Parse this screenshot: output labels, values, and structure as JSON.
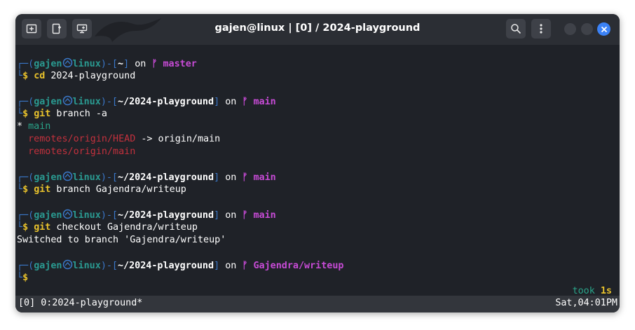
{
  "window": {
    "title": "gajen@linux | [0] / 2024-playground",
    "accent": "#3b82f6"
  },
  "toolbar": {
    "new_tab_icon": "new-tab-icon",
    "split_icon": "split-pane-icon",
    "detach_icon": "new-window-icon",
    "search_icon": "search-icon",
    "menu_icon": "kebab-menu-icon",
    "close_icon": "close-icon"
  },
  "terminal": {
    "blocks": [
      {
        "prompt": {
          "user": "gajen",
          "host": "linux",
          "path": "~",
          "on": "on",
          "branch": "master"
        },
        "command": {
          "cmd": "cd",
          "args": " 2024-playground"
        }
      },
      {
        "prompt": {
          "user": "gajen",
          "host": "linux",
          "path": "~/2024-playground",
          "on": "on",
          "branch": "main"
        },
        "command": {
          "cmd": "git",
          "args": " branch -a"
        },
        "output": [
          {
            "prefix": "* ",
            "text": "main",
            "kind": "current"
          },
          {
            "prefix": "  ",
            "text": "remotes/origin/HEAD",
            "kind": "remote",
            "suffix": " -> origin/main"
          },
          {
            "prefix": "  ",
            "text": "remotes/origin/main",
            "kind": "remote"
          }
        ]
      },
      {
        "prompt": {
          "user": "gajen",
          "host": "linux",
          "path": "~/2024-playground",
          "on": "on",
          "branch": "main"
        },
        "command": {
          "cmd": "git",
          "args": " branch Gajendra/writeup"
        }
      },
      {
        "prompt": {
          "user": "gajen",
          "host": "linux",
          "path": "~/2024-playground",
          "on": "on",
          "branch": "main"
        },
        "command": {
          "cmd": "git",
          "args": " checkout Gajendra/writeup"
        },
        "output_text": "Switched to branch 'Gajendra/writeup'"
      },
      {
        "prompt": {
          "user": "gajen",
          "host": "linux",
          "path": "~/2024-playground",
          "on": "on",
          "branch": "Gajendra/writeup"
        },
        "command": {
          "cmd": "",
          "args": ""
        }
      }
    ],
    "took_label": "took",
    "took_value": "1s"
  },
  "statusbar": {
    "left": "[0] 0:2024-playground*",
    "right": "Sat,04:01PM"
  },
  "colors": {
    "background": "#1f2228",
    "prompt_frame": "#3a78c9",
    "username": "#2a9a91",
    "branch": "#c74bd6",
    "dollar": "#e8c22c",
    "remote_branch": "#c4313d",
    "current_branch": "#2aa58a"
  }
}
